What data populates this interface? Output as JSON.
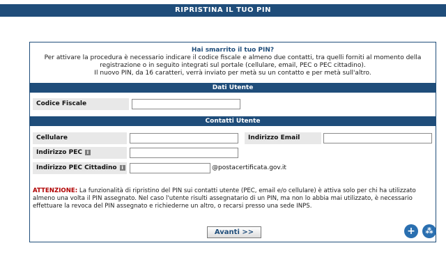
{
  "header": {
    "title": "RIPRISTINA IL TUO PIN"
  },
  "intro": {
    "question": "Hai smarrito il tuo PIN?",
    "line1": "Per attivare la procedura è necessario indicare il codice fiscale e almeno due contatti, tra quelli forniti al momento della",
    "line2": "registrazione o in seguito integrati sul portale (cellulare, email, PEC o PEC cittadino).",
    "line3": "Il nuovo PIN, da 16 caratteri, verrà inviato per metà su un contatto e per metà sull'altro."
  },
  "sections": {
    "user_data": "Dati Utente",
    "contacts": "Contatti Utente"
  },
  "fields": {
    "codice_fiscale": {
      "label": "Codice Fiscale",
      "value": ""
    },
    "cellulare": {
      "label": "Cellulare",
      "value": ""
    },
    "email": {
      "label": "Indirizzo Email",
      "value": ""
    },
    "pec": {
      "label": "Indirizzo PEC",
      "value": ""
    },
    "pec_cittadino": {
      "label": "Indirizzo PEC Cittadino",
      "value": "",
      "suffix": "@postacertificata.gov.it"
    }
  },
  "info_glyph": "i",
  "note": {
    "prefix": "ATTENZIONE:",
    "text": " La funzionalità di ripristino del PIN sui contatti utente (PEC, email e/o cellulare) è attiva solo per chi ha utilizzato almeno una volta il PIN assegnato. Nel caso l'utente risulti assegnatario di un PIN, ma non lo abbia mai utilizzato, è necessario effettuare la revoca del PIN assegnato e richiederne un altro, o recarsi presso una sede INPS."
  },
  "buttons": {
    "next": "Avanti >>",
    "zoom_in": "+",
    "share": "⁂"
  },
  "colors": {
    "primary": "#1f4d7a",
    "warning": "#b00000",
    "label_bg": "#e8e8e8"
  }
}
